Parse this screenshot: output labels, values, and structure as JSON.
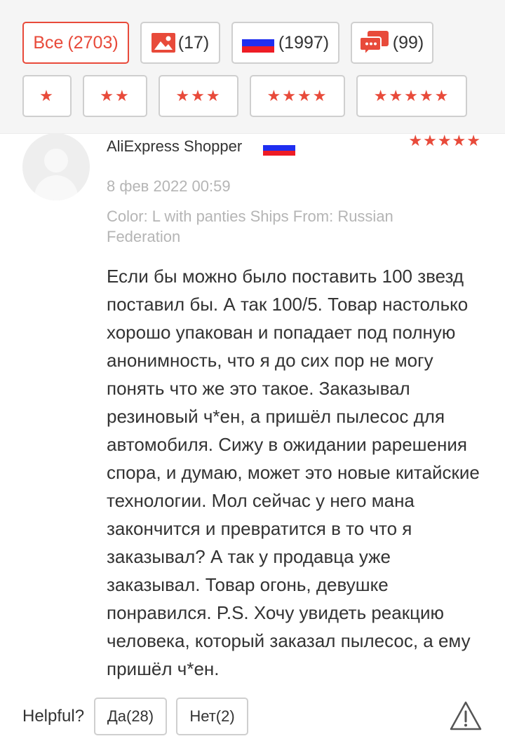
{
  "filters": {
    "all": {
      "label": "Все",
      "count": "(2703)"
    },
    "photos": {
      "icon": "photo-icon",
      "count": "(17)"
    },
    "country": {
      "icon": "russia-flag-icon",
      "count": "(1997)"
    },
    "comments": {
      "icon": "comments-icon",
      "count": "(99)"
    },
    "star_filters": [
      "★",
      "★★",
      "★★★",
      "★★★★",
      "★★★★★"
    ]
  },
  "review": {
    "author": "AliExpress Shopper",
    "country_flag": "russia-flag-icon",
    "rating": 5,
    "rating_stars": "★★★★★",
    "date": "8 фев 2022 00:59",
    "attributes": "Color: L with panties Ships From: Russian Federation",
    "text": "Если бы можно было поставить 100 звезд поставил бы. А так 100/5. Товар настолько хорошо упакован и попадает под полную анонимность, что я до сих пор не могу понять что же это такое. Заказывал резиновый ч*ен, а пришёл пылесос для автомобиля. Сижу в ожидании рарешения спора, и думаю, может это новые китайские технологии. Мол сейчас у него мана закончится и превратится в то что я заказывал? А так у продавца уже заказывал. Товар огонь, девушке понравился. P.S. Хочу увидеть реакцию человека, который заказал пылесос, а ему пришёл ч*ен."
  },
  "helpful": {
    "label": "Helpful?",
    "yes": "Да(28)",
    "no": "Нет(2)"
  },
  "colors": {
    "accent": "#e84a3a",
    "muted_text": "#b5b5b5",
    "border": "#cfcfcf"
  }
}
